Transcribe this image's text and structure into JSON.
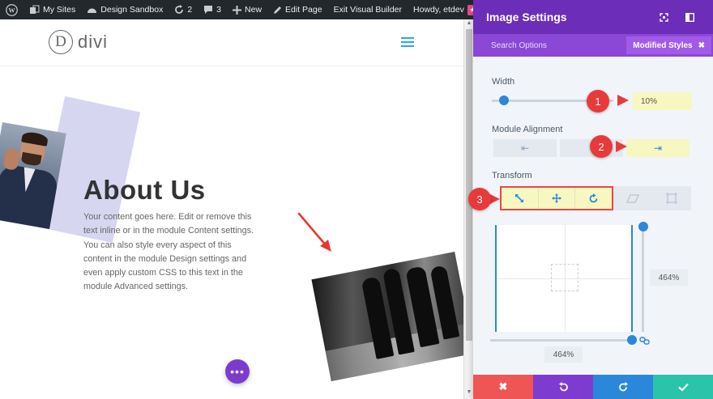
{
  "admin_bar": {
    "my_sites": "My Sites",
    "site_name": "Design Sandbox",
    "updates_count": "2",
    "comments_count": "3",
    "new_label": "New",
    "edit_page": "Edit Page",
    "exit_builder": "Exit Visual Builder",
    "howdy": "Howdy, etdev"
  },
  "site": {
    "logo_letter": "D",
    "logo_word": "divi"
  },
  "content": {
    "heading": "About Us",
    "body_text": "Your content goes here. Edit or remove this text inline or in the module Content settings. You can also style every aspect of this content in the module Design settings and even apply custom CSS to this text in the module Advanced settings.",
    "fab_label": "•••"
  },
  "panel": {
    "title": "Image Settings",
    "search_label": "Search Options",
    "modified_styles": "Modified Styles",
    "width_label": "Width",
    "width_value": "10%",
    "width_fraction": 0.1,
    "alignment_label": "Module Alignment",
    "alignment_options": [
      "left",
      "center",
      "right"
    ],
    "alignment_selected": "right",
    "transform_label": "Transform",
    "transform_tabs": [
      "scale",
      "translate",
      "rotate",
      "skew",
      "origin"
    ],
    "transform_selected": [
      "scale",
      "translate",
      "rotate"
    ],
    "scale_y": "464%",
    "scale_x": "464%"
  },
  "annotations": [
    "1",
    "2",
    "3"
  ],
  "colors": {
    "panel_header": "#6c2eb9",
    "panel_sub": "#8b47d6",
    "accent_blue": "#2b87da",
    "highlight": "#f6f7c1",
    "callout_red": "#e83a3a",
    "footer_cancel": "#ef5555",
    "footer_undo": "#7e3bd0",
    "footer_redo": "#2b87da",
    "footer_save": "#29c4a9"
  },
  "icons": {
    "wp_logo": "wordpress-icon",
    "footer": [
      "close-icon",
      "undo-icon",
      "redo-icon",
      "check-icon"
    ]
  }
}
